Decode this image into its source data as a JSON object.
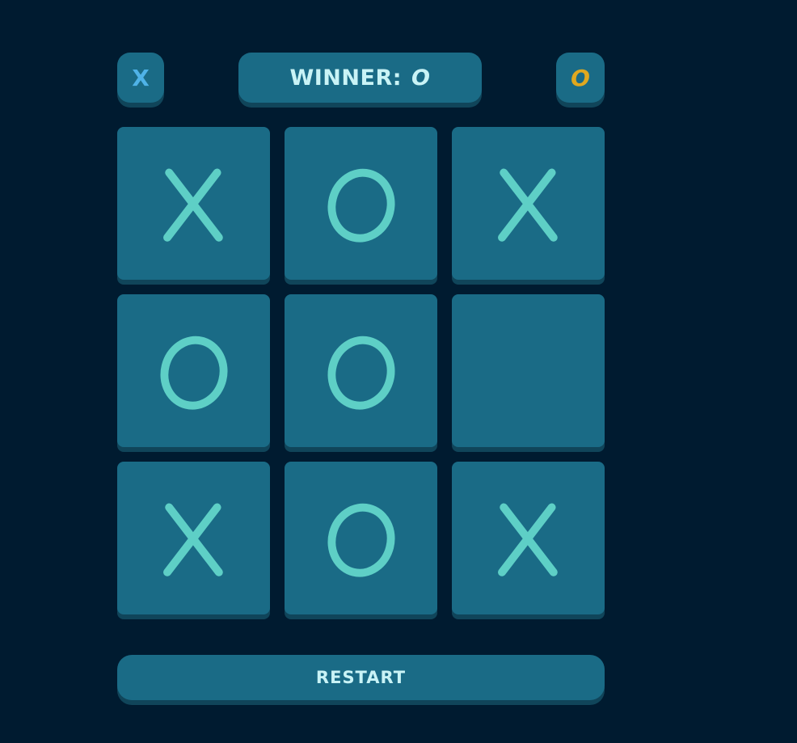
{
  "players": {
    "x_label": "X",
    "o_label": "O"
  },
  "status": {
    "prefix": "WINNER:",
    "winner": "O"
  },
  "board": {
    "cells": [
      "X",
      "O",
      "X",
      "O",
      "O",
      "",
      "X",
      "O",
      "X"
    ]
  },
  "controls": {
    "restart_label": "RESTART"
  },
  "colors": {
    "background": "#001b30",
    "tile": "#1a6b86",
    "tile_shadow": "#10455a",
    "mark": "#5ecfc6",
    "x_indicator": "#4fb3e8",
    "o_indicator": "#e0a81f",
    "text": "#c9f3f6"
  },
  "icons": {
    "x_mark": "x-mark-icon",
    "o_mark": "o-mark-icon"
  }
}
